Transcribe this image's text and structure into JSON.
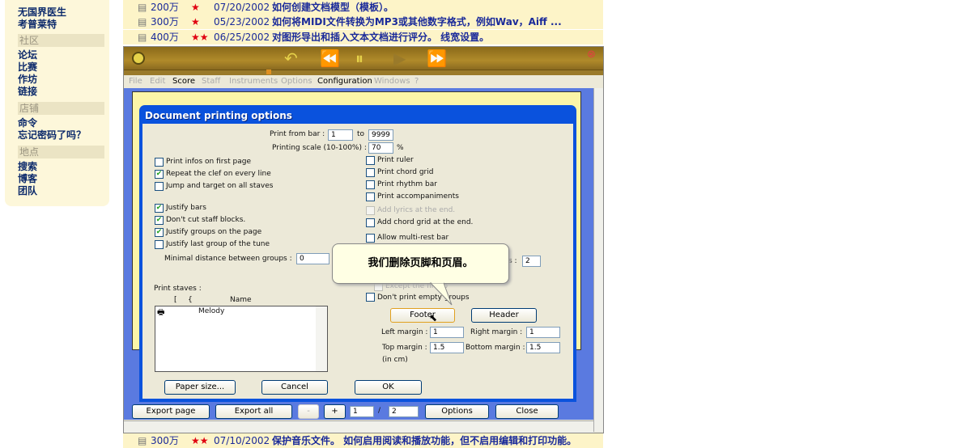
{
  "sidebar": {
    "items_top": [
      "无国界医生",
      "考普莱特"
    ],
    "sections": [
      {
        "title": "社区",
        "items": [
          "论坛",
          "比赛",
          "作坊",
          "链接"
        ]
      },
      {
        "title": "店铺",
        "items": [
          "命令",
          "忘记密码了吗？"
        ]
      },
      {
        "title": "地点",
        "items": [
          "搜索",
          "博客",
          "团队"
        ]
      }
    ]
  },
  "rows": [
    {
      "count": "200万",
      "stars": "★",
      "date": "07/20/2002",
      "title": "如何创建文档模型（模板）。"
    },
    {
      "count": "300万",
      "stars": "★",
      "date": "05/23/2002",
      "title": "如何将MIDI文件转换为MP3或其他数字格式，例如Wav，Aiff ..."
    },
    {
      "count": "400万",
      "stars": "★★",
      "date": "06/25/2002",
      "title": "对图形导出和插入文本文档进行评分。 线宽设置。"
    },
    {
      "count": "300万",
      "stars": "★★",
      "date": "07/10/2002",
      "title": "保护音乐文件。 如何启用阅读和播放功能，但不启用编辑和打印功能。"
    }
  ],
  "player": {
    "controls": [
      "↶",
      "⏪",
      "⏸",
      "▶",
      "⏩"
    ],
    "close": "⊗"
  },
  "menu": [
    "File",
    "Edit",
    "Score",
    "Staff",
    "Instruments",
    "Options",
    "Configuration",
    "Windows",
    "?"
  ],
  "dialog": {
    "title": "Document printing options",
    "from_label": "Print from bar :",
    "from": "1",
    "to_label": "to",
    "to": "9999",
    "scale_label": "Printing scale (10-100%) :",
    "scale": "70",
    "pct": "%",
    "left_opts": [
      {
        "label": "Print infos on first page",
        "checked": false
      },
      {
        "label": "Repeat the clef on every line",
        "checked": true
      },
      {
        "label": "Jump and target on all staves",
        "checked": false
      },
      {
        "label": "Justify bars",
        "checked": true
      },
      {
        "label": "Don't cut staff blocks.",
        "checked": true
      },
      {
        "label": "Justify groups on the page",
        "checked": true
      },
      {
        "label": "Justify last group of the tune",
        "checked": false
      }
    ],
    "min_dist_label": "Minimal distance between groups :",
    "min_dist": "0",
    "right_opts": [
      {
        "label": "Print ruler",
        "checked": false
      },
      {
        "label": "Print chord grid",
        "checked": false
      },
      {
        "label": "Print rhythm bar",
        "checked": false
      },
      {
        "label": "Print accompaniments",
        "checked": false
      },
      {
        "label": "Add lyrics at the end.",
        "checked": false,
        "disabled": true
      },
      {
        "label": "Add chord grid at the end.",
        "checked": false
      },
      {
        "label": "Allow multi-rest bar",
        "checked": false
      }
    ],
    "hidden_label": "s :",
    "hidden_value": "2",
    "except_first": "Except the first o",
    "empty_groups": "Don't print empty groups",
    "staves_label": "Print staves :",
    "staves_cols": [
      "[",
      "{",
      "Name"
    ],
    "staves": [
      "Melody"
    ],
    "footer": "Footer",
    "header": "Header",
    "left_margin_label": "Left margin :",
    "left_margin": "1",
    "right_margin_label": "Right margin :",
    "right_margin": "1",
    "top_margin_label": "Top margin :",
    "top_margin": "1.5",
    "bottom_margin_label": "Bottom margin :",
    "bottom_margin": "1.5",
    "units": "(in cm)",
    "paper": "Paper size...",
    "cancel": "Cancel",
    "ok": "OK"
  },
  "toolbar": {
    "export_page": "Export page",
    "export_all": "Export all",
    "minus": "-",
    "plus": "+",
    "page": "1",
    "sep": "/",
    "pages": "2",
    "options": "Options",
    "close": "Close"
  },
  "tooltip": "我们删除页脚和页眉。"
}
